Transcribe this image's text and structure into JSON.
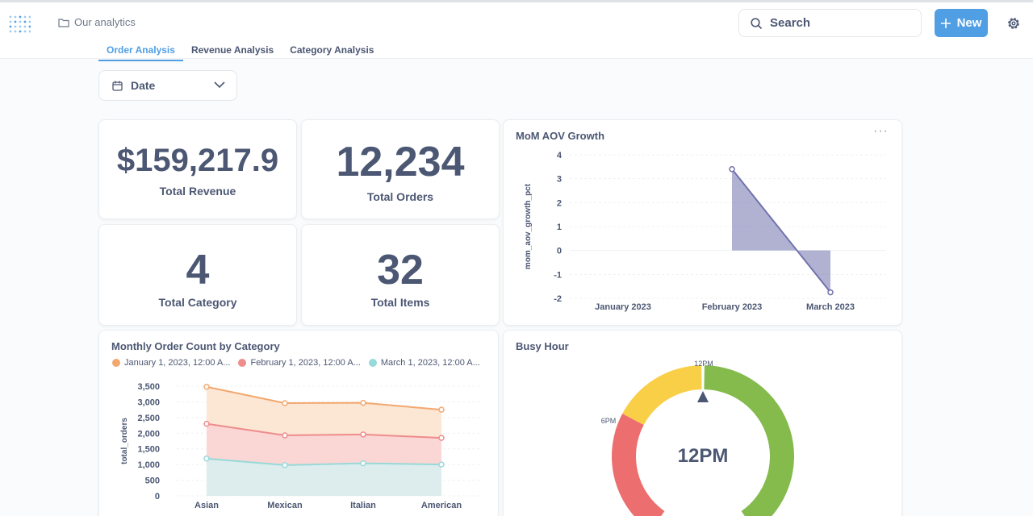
{
  "breadcrumb": {
    "label": "Our analytics"
  },
  "search": {
    "label": "Search"
  },
  "new_button": {
    "label": "New"
  },
  "tabs": [
    {
      "label": "Order Analysis",
      "active": true
    },
    {
      "label": "Revenue Analysis",
      "active": false
    },
    {
      "label": "Category Analysis",
      "active": false
    }
  ],
  "filter": {
    "label": "Date"
  },
  "scalars": [
    {
      "value": "$159,217.9",
      "label": "Total Revenue"
    },
    {
      "value": "12,234",
      "label": "Total Orders"
    },
    {
      "value": "4",
      "label": "Total Category"
    },
    {
      "value": "32",
      "label": "Total Items"
    }
  ],
  "colors": {
    "accent": "#509ee3",
    "text": "#4c5773",
    "series_orange": "#f2a86f",
    "series_red": "#ef8c8c",
    "series_teal": "#98d9d9",
    "aov": "#7172ad",
    "gauge_red": "#ed6e6e",
    "gauge_yellow": "#f9cf48",
    "gauge_green": "#84bb4c"
  },
  "chart_data": [
    {
      "type": "area",
      "title": "MoM AOV Growth",
      "categories": [
        "January 2023",
        "February 2023",
        "March 2023"
      ],
      "series": [
        {
          "values": [
            null,
            3.4,
            -1.75
          ]
        }
      ],
      "ylabel": "mom_aov_growth_pct",
      "xlabel": "",
      "ylim": [
        -2,
        4
      ],
      "yticks": [
        "4",
        "3",
        "2",
        "1",
        "0",
        "-1",
        "-2"
      ],
      "grid": true
    },
    {
      "type": "area",
      "title": "Monthly Order Count by Category",
      "categories": [
        "Asian",
        "Mexican",
        "Italian",
        "American"
      ],
      "series": [
        {
          "name": "January 1, 2023, 12:00 A...",
          "values": [
            3480,
            2960,
            2970,
            2750
          ]
        },
        {
          "name": "February 1, 2023, 12:00 A...",
          "values": [
            2300,
            1930,
            1960,
            1850
          ]
        },
        {
          "name": "March 1, 2023, 12:00 A...",
          "values": [
            1190,
            980,
            1040,
            1000
          ]
        }
      ],
      "ylabel": "total_orders",
      "xlabel": "",
      "ylim": [
        0,
        3500
      ],
      "yticks": [
        "3,500",
        "3,000",
        "2,500",
        "2,000",
        "1,500",
        "1,000",
        "500",
        "0"
      ],
      "legend": "top-left",
      "grid": true
    },
    {
      "type": "gauge",
      "title": "Busy Hour",
      "value": 12,
      "value_label": "12PM",
      "segment_labels": [
        "6PM",
        "12PM"
      ]
    }
  ]
}
